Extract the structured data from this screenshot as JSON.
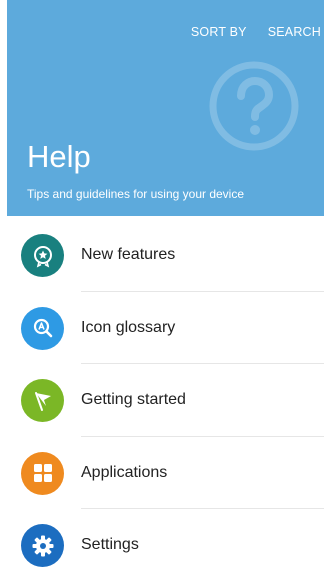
{
  "header": {
    "title": "Help",
    "subtitle": "Tips and guidelines for using your device",
    "sort_label": "SORT BY",
    "search_label": "SEARCH",
    "background_color": "#5daadc"
  },
  "items": [
    {
      "label": "New features",
      "icon": "badge-star-icon",
      "color": "#19807f"
    },
    {
      "label": "Icon glossary",
      "icon": "magnifier-a-icon",
      "color": "#2e9ae4"
    },
    {
      "label": "Getting started",
      "icon": "flag-icon",
      "color": "#7bb726"
    },
    {
      "label": "Applications",
      "icon": "apps-grid-icon",
      "color": "#ef8a1f"
    },
    {
      "label": "Settings",
      "icon": "gear-icon",
      "color": "#1c6dc0"
    }
  ]
}
